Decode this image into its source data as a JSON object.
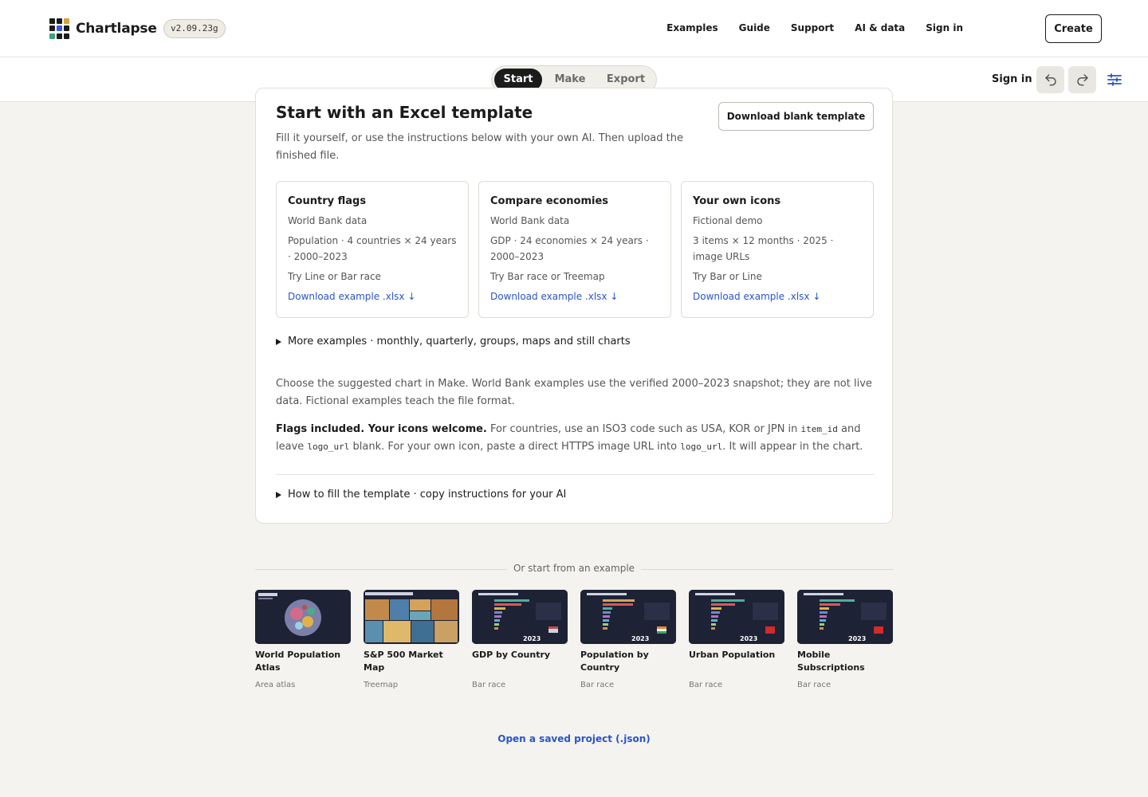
{
  "app": {
    "brand": "Chartlapse",
    "version": "v2.09.23g"
  },
  "nav": {
    "items": [
      "Examples",
      "Guide",
      "Support",
      "AI & data",
      "Sign in"
    ],
    "create_label": "Create"
  },
  "toolbar": {
    "steps": [
      "Start",
      "Make",
      "Export"
    ],
    "active_step": "Start",
    "signin_label": "Sign in"
  },
  "template": {
    "title": "Start with an Excel template",
    "subtitle": "Fill it yourself, or use the instructions below with your own AI. Then upload the finished file.",
    "download_blank": "Download blank template",
    "cards": [
      {
        "title": "Country flags",
        "source": "World Bank data",
        "meta": "Population · 4 countries × 24 years · 2000–2023",
        "hint": "Try Line or Bar race",
        "link": "Download example .xlsx ↓"
      },
      {
        "title": "Compare economies",
        "source": "World Bank data",
        "meta": "GDP · 24 economies × 24 years · 2000–2023",
        "hint": "Try Bar race or Treemap",
        "link": "Download example .xlsx ↓"
      },
      {
        "title": "Your own icons",
        "source": "Fictional demo",
        "meta": "3 items × 12 months · 2025 · image URLs",
        "hint": "Try Bar or Line",
        "link": "Download example .xlsx ↓"
      }
    ],
    "more_examples": "More examples · monthly, quarterly, groups, maps and still charts",
    "note1": "Choose the suggested chart in Make. World Bank examples use the verified 2000–2023 snapshot; they are not live data. Fictional examples teach the file format.",
    "note2_bold": "Flags included. Your icons welcome.",
    "note2_a": " For countries, use an ISO3 code such as USA, KOR or JPN in ",
    "note2_code1": "item_id",
    "note2_b": " and leave ",
    "note2_code2": "logo_url",
    "note2_c": " blank. For your own icon, paste a direct HTTPS image URL into ",
    "note2_code3": "logo_url",
    "note2_d": ". It will appear in the chart.",
    "how_to": "How to fill the template · copy instructions for your AI"
  },
  "examples": {
    "heading": "Or start from an example",
    "items": [
      {
        "name": "World Population Atlas",
        "type": "Area atlas"
      },
      {
        "name": "S&P 500 Market Map",
        "type": "Treemap"
      },
      {
        "name": "GDP by Country",
        "type": "Bar race",
        "year": "2023"
      },
      {
        "name": "Population by Country",
        "type": "Bar race",
        "year": "2023"
      },
      {
        "name": "Urban Population",
        "type": "Bar race",
        "year": "2023"
      },
      {
        "name": "Mobile Subscriptions",
        "type": "Bar race",
        "year": "2023"
      }
    ],
    "open_saved": "Open a saved project (.json)"
  },
  "colors": {
    "accent_link": "#2a55c7",
    "thumb_bg": "#1d2235",
    "active_step_bg": "#1b1b1b"
  }
}
